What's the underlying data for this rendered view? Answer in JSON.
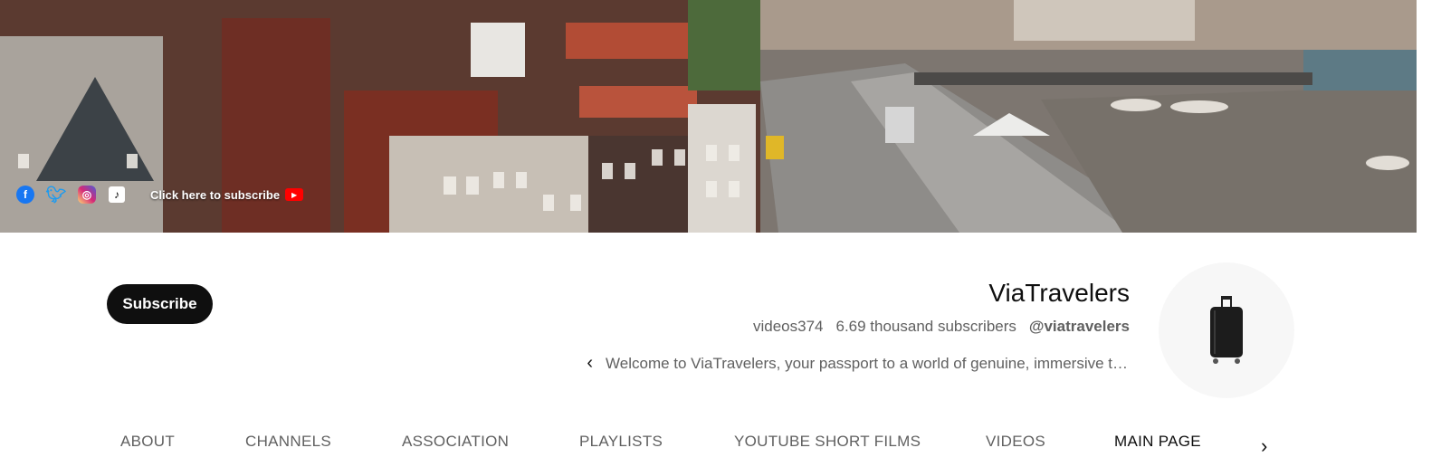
{
  "banner": {
    "social_icons": [
      "facebook-icon",
      "twitter-icon",
      "instagram-icon",
      "tiktok-icon"
    ],
    "cta_text": "Click here to subscribe",
    "cta_icon": "youtube-icon"
  },
  "header": {
    "subscribe_label": "Subscribe",
    "channel_name": "ViaTravelers",
    "videos": "videos374",
    "subscribers": "6.69 thousand subscribers",
    "handle": "@viatravelers",
    "description": "Welcome to ViaTravelers, your passport to a world of genuine, immersive t…",
    "avatar_icon": "suitcase-icon"
  },
  "tabs": [
    {
      "label": "ABOUT"
    },
    {
      "label": "CHANNELS"
    },
    {
      "label": "ASSOCIATION"
    },
    {
      "label": "PLAYLISTS"
    },
    {
      "label": "YOUTUBE SHORT FILMS"
    },
    {
      "label": "VIDEOS"
    },
    {
      "label": "MAIN PAGE",
      "active": true
    }
  ],
  "colors": {
    "subscribe_bg": "#0f0f0f",
    "muted_text": "#606060",
    "youtube_red": "#ff0000"
  }
}
